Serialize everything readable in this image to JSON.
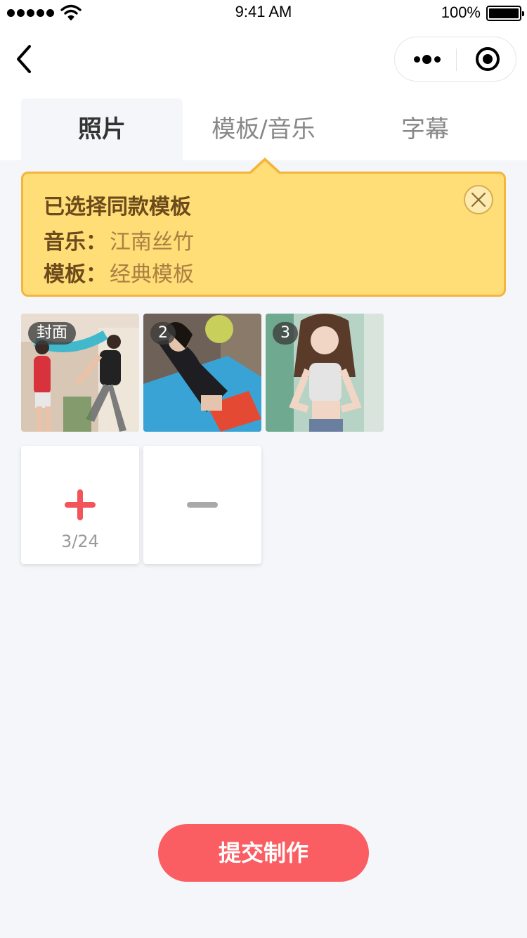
{
  "status_bar": {
    "time": "9:41 AM",
    "battery_percent": "100%",
    "battery_level": 1.0
  },
  "nav": {
    "back_icon": "chevron-left-icon",
    "more_icon": "more-dots-icon",
    "close_icon": "target-circle-icon"
  },
  "tabs": [
    {
      "label": "照片",
      "active": true
    },
    {
      "label": "模板/音乐",
      "active": false
    },
    {
      "label": "字幕",
      "active": false
    }
  ],
  "notice": {
    "title": "已选择同款模板",
    "music_label": "音乐：",
    "music_value": "江南丝竹",
    "template_label": "模板：",
    "template_value": "经典模板",
    "close_icon": "close-circle-icon",
    "colors": {
      "background": "#ffdd77",
      "border": "#f5b43c"
    }
  },
  "photos": [
    {
      "badge": "封面"
    },
    {
      "badge": "2"
    },
    {
      "badge": "3"
    }
  ],
  "actions": {
    "add_icon": "plus-icon",
    "count": "3/24",
    "remove_icon": "minus-icon"
  },
  "submit": {
    "label": "提交制作",
    "color": "#fb5e62"
  }
}
